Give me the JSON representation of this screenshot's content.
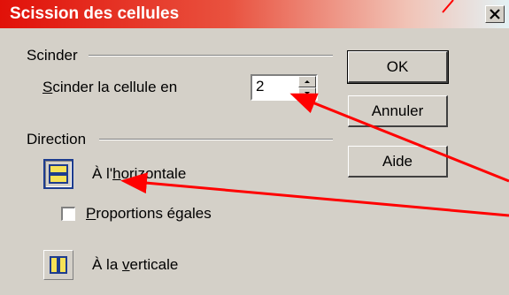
{
  "window": {
    "title": "Scission des cellules",
    "close_glyph": "×"
  },
  "split_group": {
    "label": "Scinder",
    "field_label_prefix": "",
    "field_label_underlined": "S",
    "field_label_rest": "cinder la cellule en",
    "value": "2"
  },
  "direction_group": {
    "label": "Direction",
    "horizontal": {
      "label_prefix": "À l'",
      "label_underlined": "h",
      "label_rest": "orizontale",
      "icon": "split-horizontal-icon",
      "selected": true
    },
    "equal_proportions": {
      "label_underlined": "P",
      "label_rest": "roportions égales",
      "checked": false
    },
    "vertical": {
      "label_prefix": "À la ",
      "label_underlined": "v",
      "label_rest": "erticale",
      "icon": "split-vertical-icon",
      "selected": false
    }
  },
  "buttons": {
    "ok": "OK",
    "cancel": "Annuler",
    "help": "Aide"
  },
  "colors": {
    "titlebar_start": "#e11109",
    "titlebar_end": "#e3f1f4",
    "dialog_bg": "#d4d0c8",
    "annotation_arrow": "#ff0000",
    "icon_fill": "#f6e257",
    "icon_border": "#1d3c8f"
  }
}
